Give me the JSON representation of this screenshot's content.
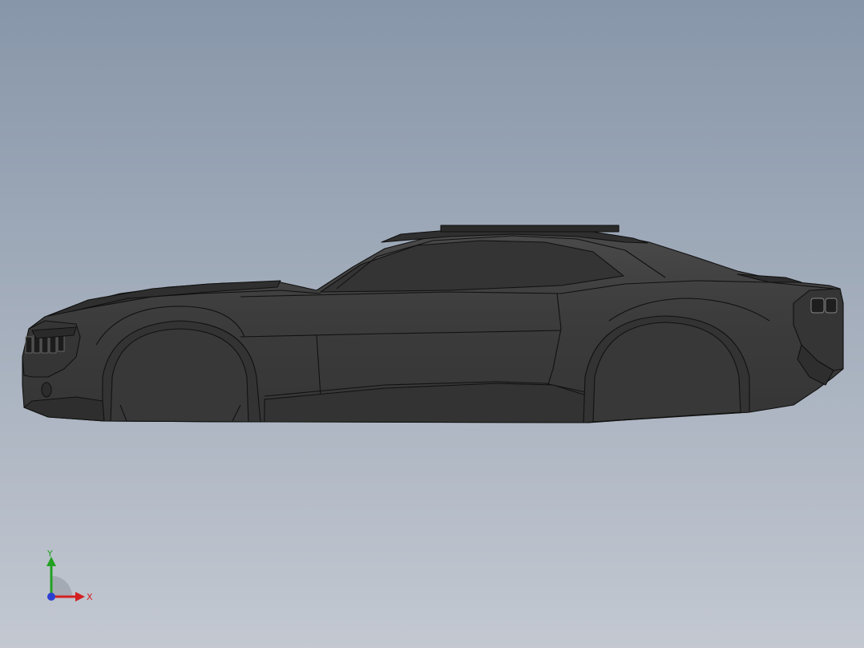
{
  "viewport": {
    "background_top": "#8796a9",
    "background_bottom": "#c3c8d1"
  },
  "model": {
    "body_color": "#3d3d3d",
    "edge_color": "#111111",
    "shade_color": "#2e2e2e",
    "highlight_color": "#565656"
  },
  "triad": {
    "x_label": "X",
    "y_label": "Y",
    "x_color": "#d42020",
    "y_color": "#22a022",
    "z_color": "#2b3fd1"
  }
}
